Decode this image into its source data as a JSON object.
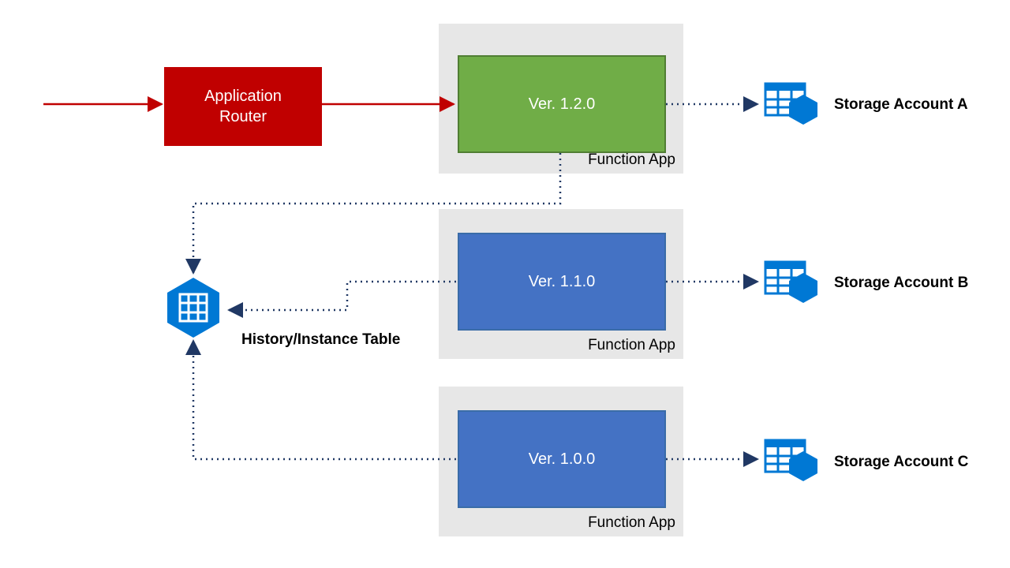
{
  "router": {
    "line1": "Application",
    "line2": "Router"
  },
  "functionAppLabel": "Function App",
  "versions": {
    "v0": "Ver. 1.2.0",
    "v1": "Ver. 1.1.0",
    "v2": "Ver. 1.0.0"
  },
  "storage": {
    "a": "Storage Account A",
    "b": "Storage Account B",
    "c": "Storage Account C"
  },
  "historyTable": "History/Instance Table",
  "colors": {
    "red": "#c00000",
    "green": "#70ad47",
    "blue": "#4472c4",
    "azureBlue": "#0078d4",
    "navy": "#203864",
    "grey": "#e7e7e7"
  },
  "chart_data": {
    "type": "diagram",
    "title": "Application Router versioned Function Apps with shared History/Instance Table",
    "nodes": [
      {
        "id": "router",
        "label": "Application Router",
        "kind": "router"
      },
      {
        "id": "fn120",
        "label": "Ver. 1.2.0",
        "kind": "function-app",
        "container": "Function App",
        "active": true
      },
      {
        "id": "fn110",
        "label": "Ver. 1.1.0",
        "kind": "function-app",
        "container": "Function App",
        "active": false
      },
      {
        "id": "fn100",
        "label": "Ver. 1.0.0",
        "kind": "function-app",
        "container": "Function App",
        "active": false
      },
      {
        "id": "history",
        "label": "History/Instance Table",
        "kind": "storage-table"
      },
      {
        "id": "stgA",
        "label": "Storage Account A",
        "kind": "storage-account"
      },
      {
        "id": "stgB",
        "label": "Storage Account B",
        "kind": "storage-account"
      },
      {
        "id": "stgC",
        "label": "Storage Account C",
        "kind": "storage-account"
      }
    ],
    "edges": [
      {
        "from": "ingress",
        "to": "router",
        "style": "solid",
        "color": "red"
      },
      {
        "from": "router",
        "to": "fn120",
        "style": "solid",
        "color": "red"
      },
      {
        "from": "fn120",
        "to": "stgA",
        "style": "dotted",
        "color": "navy"
      },
      {
        "from": "fn110",
        "to": "stgB",
        "style": "dotted",
        "color": "navy"
      },
      {
        "from": "fn100",
        "to": "stgC",
        "style": "dotted",
        "color": "navy"
      },
      {
        "from": "fn120",
        "to": "history",
        "style": "dotted",
        "color": "navy"
      },
      {
        "from": "fn110",
        "to": "history",
        "style": "dotted",
        "color": "navy"
      },
      {
        "from": "fn100",
        "to": "history",
        "style": "dotted",
        "color": "navy"
      }
    ]
  }
}
